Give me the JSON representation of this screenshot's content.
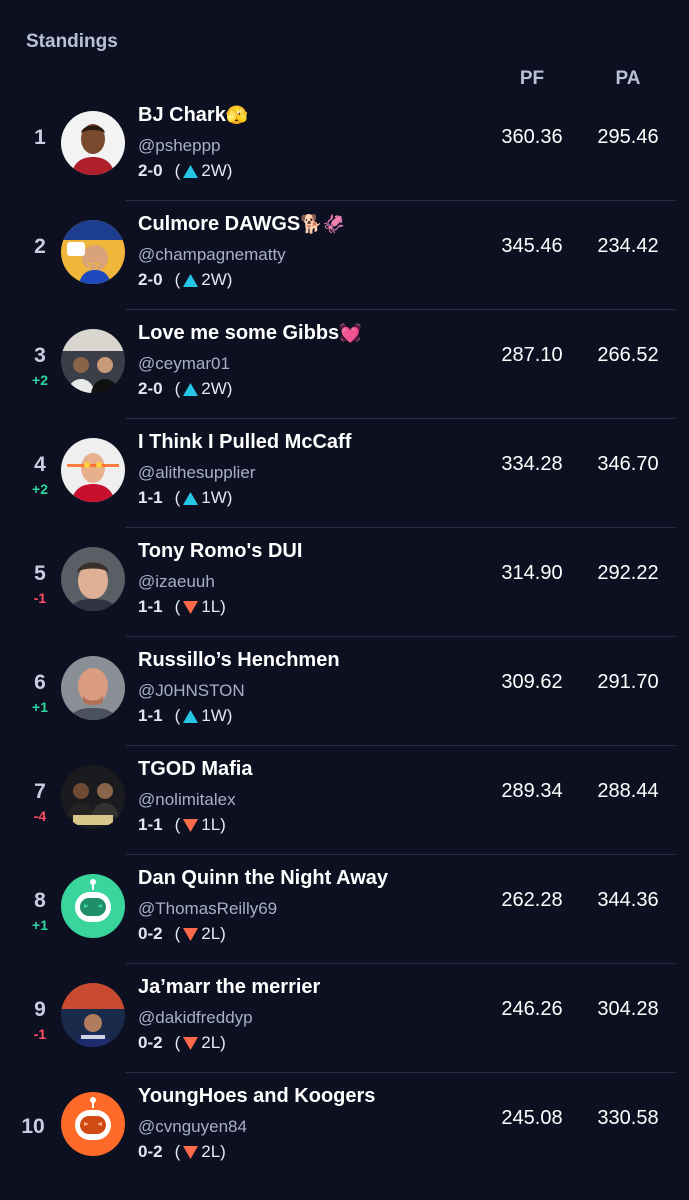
{
  "header": {
    "title": "Standings",
    "pf_label": "PF",
    "pa_label": "PA"
  },
  "teams": [
    {
      "rank": "1",
      "move": "",
      "name": "BJ Chark",
      "emoji": "🫣",
      "handle": "@psheppp",
      "record": "2-0",
      "streak_open": "(",
      "streak": "2W)",
      "dir": "up",
      "pf": "360.36",
      "pa": "295.46"
    },
    {
      "rank": "2",
      "move": "",
      "name": "Culmore DAWGS",
      "emoji": "🐕🦑",
      "handle": "@champagnematty",
      "record": "2-0",
      "streak_open": "(",
      "streak": "2W)",
      "dir": "up",
      "pf": "345.46",
      "pa": "234.42"
    },
    {
      "rank": "3",
      "move": "+2",
      "name": "Love me some Gibbs",
      "emoji": "💓",
      "handle": "@ceymar01",
      "record": "2-0",
      "streak_open": "(",
      "streak": "2W)",
      "dir": "up",
      "pf": "287.10",
      "pa": "266.52"
    },
    {
      "rank": "4",
      "move": "+2",
      "name": "I Think I Pulled McCaff",
      "emoji": "",
      "handle": "@alithesupplier",
      "record": "1-1",
      "streak_open": "(",
      "streak": "1W)",
      "dir": "up",
      "pf": "334.28",
      "pa": "346.70"
    },
    {
      "rank": "5",
      "move": "-1",
      "name": "Tony Romo's DUI",
      "emoji": "",
      "handle": "@izaeuuh",
      "record": "1-1",
      "streak_open": "(",
      "streak": "1L)",
      "dir": "down",
      "pf": "314.90",
      "pa": "292.22"
    },
    {
      "rank": "6",
      "move": "+1",
      "name": "Russillo’s Henchmen",
      "emoji": "",
      "handle": "@J0HNSTON",
      "record": "1-1",
      "streak_open": "(",
      "streak": "1W)",
      "dir": "up",
      "pf": "309.62",
      "pa": "291.70"
    },
    {
      "rank": "7",
      "move": "-4",
      "name": "TGOD Mafia",
      "emoji": "",
      "handle": "@nolimitalex",
      "record": "1-1",
      "streak_open": "(",
      "streak": "1L)",
      "dir": "down",
      "pf": "289.34",
      "pa": "288.44"
    },
    {
      "rank": "8",
      "move": "+1",
      "name": "Dan Quinn the Night Away",
      "emoji": "",
      "handle": "@ThomasReilly69",
      "record": "0-2",
      "streak_open": "(",
      "streak": "2L)",
      "dir": "down",
      "pf": "262.28",
      "pa": "344.36"
    },
    {
      "rank": "9",
      "move": "-1",
      "name": "Ja’marr the merrier",
      "emoji": "",
      "handle": "@dakidfreddyp",
      "record": "0-2",
      "streak_open": "(",
      "streak": "2L)",
      "dir": "down",
      "pf": "246.26",
      "pa": "304.28"
    },
    {
      "rank": "10",
      "move": "",
      "name": "YoungHoes and Koogers",
      "emoji": "",
      "handle": "@cvnguyen84",
      "record": "0-2",
      "streak_open": "(",
      "streak": "2L)",
      "dir": "down",
      "pf": "245.08",
      "pa": "330.58"
    }
  ],
  "colors": {
    "up": "#25c6e6",
    "down": "#ff6b4a",
    "move_up": "#2fd6a0",
    "move_down": "#ff4d67"
  }
}
